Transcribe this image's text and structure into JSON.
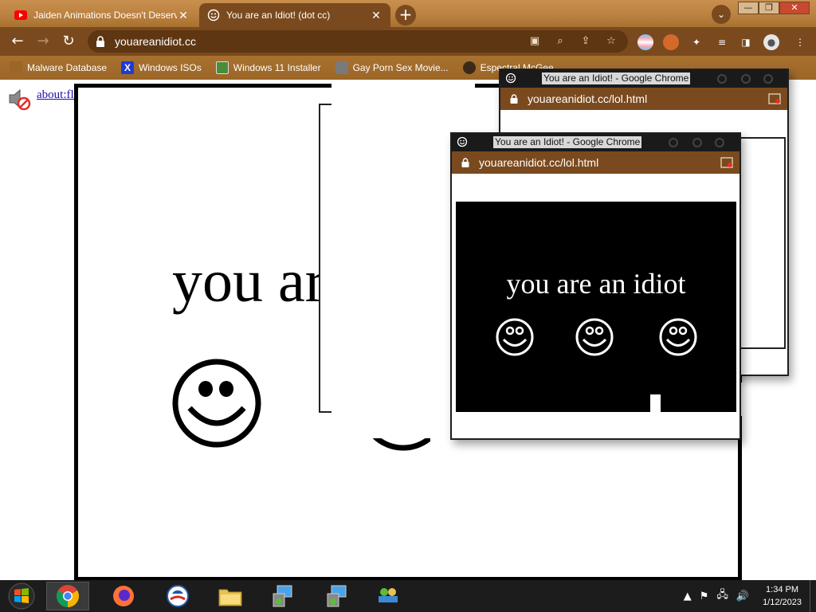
{
  "tabs": [
    {
      "title": "Jaiden Animations Doesn't Deserve",
      "close": "✕"
    },
    {
      "title": "You are an Idiot! (dot cc)",
      "close": "✕"
    }
  ],
  "newtab": "+",
  "tabsearch": "⌄",
  "window_controls": {
    "minimize": "—",
    "restore": "❐",
    "close": "✕"
  },
  "toolbar": {
    "back": "←",
    "forward": "→",
    "reload": "↻",
    "url": "youareanidiot.cc"
  },
  "bookmarks": [
    {
      "label": "Malware Database",
      "color": "#9c6628"
    },
    {
      "label": "Windows ISOs",
      "color": "#1e3bd6"
    },
    {
      "label": "Windows 11 Installer",
      "color": "#4a8c3a"
    },
    {
      "label": "Gay Porn Sex Movie...",
      "color": "#7a7a7a"
    },
    {
      "label": "Espectral McGee",
      "color": "#3b2a1a"
    }
  ],
  "page": {
    "link": "about:flash",
    "big_text": "you are an idiot"
  },
  "popup": {
    "title": "You are an Idiot! - Google Chrome",
    "url": "youareanidiot.cc/lol.html",
    "text": "you are an idiot"
  },
  "taskbar": {
    "time": "1:34 PM",
    "date": "1/12/2023"
  },
  "colors": {
    "accent": "#7a4a1e",
    "tab_strip": "#b9803f",
    "taskbar": "#1c1c1c"
  }
}
